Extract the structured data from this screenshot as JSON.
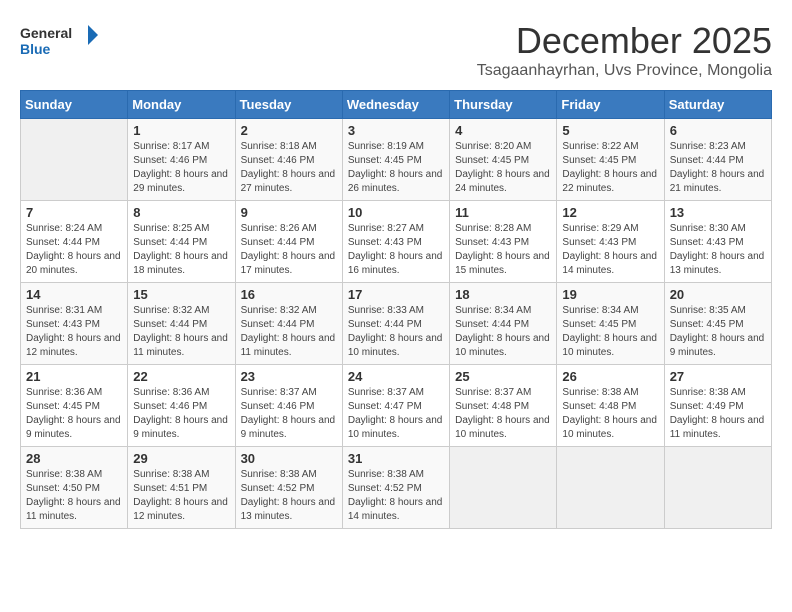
{
  "logo": {
    "line1": "General",
    "line2": "Blue"
  },
  "title": "December 2025",
  "location": "Tsagaanhayrhan, Uvs Province, Mongolia",
  "weekdays": [
    "Sunday",
    "Monday",
    "Tuesday",
    "Wednesday",
    "Thursday",
    "Friday",
    "Saturday"
  ],
  "weeks": [
    [
      {
        "day": "",
        "sunrise": "",
        "sunset": "",
        "daylight": ""
      },
      {
        "day": "1",
        "sunrise": "Sunrise: 8:17 AM",
        "sunset": "Sunset: 4:46 PM",
        "daylight": "Daylight: 8 hours and 29 minutes."
      },
      {
        "day": "2",
        "sunrise": "Sunrise: 8:18 AM",
        "sunset": "Sunset: 4:46 PM",
        "daylight": "Daylight: 8 hours and 27 minutes."
      },
      {
        "day": "3",
        "sunrise": "Sunrise: 8:19 AM",
        "sunset": "Sunset: 4:45 PM",
        "daylight": "Daylight: 8 hours and 26 minutes."
      },
      {
        "day": "4",
        "sunrise": "Sunrise: 8:20 AM",
        "sunset": "Sunset: 4:45 PM",
        "daylight": "Daylight: 8 hours and 24 minutes."
      },
      {
        "day": "5",
        "sunrise": "Sunrise: 8:22 AM",
        "sunset": "Sunset: 4:45 PM",
        "daylight": "Daylight: 8 hours and 22 minutes."
      },
      {
        "day": "6",
        "sunrise": "Sunrise: 8:23 AM",
        "sunset": "Sunset: 4:44 PM",
        "daylight": "Daylight: 8 hours and 21 minutes."
      }
    ],
    [
      {
        "day": "7",
        "sunrise": "Sunrise: 8:24 AM",
        "sunset": "Sunset: 4:44 PM",
        "daylight": "Daylight: 8 hours and 20 minutes."
      },
      {
        "day": "8",
        "sunrise": "Sunrise: 8:25 AM",
        "sunset": "Sunset: 4:44 PM",
        "daylight": "Daylight: 8 hours and 18 minutes."
      },
      {
        "day": "9",
        "sunrise": "Sunrise: 8:26 AM",
        "sunset": "Sunset: 4:44 PM",
        "daylight": "Daylight: 8 hours and 17 minutes."
      },
      {
        "day": "10",
        "sunrise": "Sunrise: 8:27 AM",
        "sunset": "Sunset: 4:43 PM",
        "daylight": "Daylight: 8 hours and 16 minutes."
      },
      {
        "day": "11",
        "sunrise": "Sunrise: 8:28 AM",
        "sunset": "Sunset: 4:43 PM",
        "daylight": "Daylight: 8 hours and 15 minutes."
      },
      {
        "day": "12",
        "sunrise": "Sunrise: 8:29 AM",
        "sunset": "Sunset: 4:43 PM",
        "daylight": "Daylight: 8 hours and 14 minutes."
      },
      {
        "day": "13",
        "sunrise": "Sunrise: 8:30 AM",
        "sunset": "Sunset: 4:43 PM",
        "daylight": "Daylight: 8 hours and 13 minutes."
      }
    ],
    [
      {
        "day": "14",
        "sunrise": "Sunrise: 8:31 AM",
        "sunset": "Sunset: 4:43 PM",
        "daylight": "Daylight: 8 hours and 12 minutes."
      },
      {
        "day": "15",
        "sunrise": "Sunrise: 8:32 AM",
        "sunset": "Sunset: 4:44 PM",
        "daylight": "Daylight: 8 hours and 11 minutes."
      },
      {
        "day": "16",
        "sunrise": "Sunrise: 8:32 AM",
        "sunset": "Sunset: 4:44 PM",
        "daylight": "Daylight: 8 hours and 11 minutes."
      },
      {
        "day": "17",
        "sunrise": "Sunrise: 8:33 AM",
        "sunset": "Sunset: 4:44 PM",
        "daylight": "Daylight: 8 hours and 10 minutes."
      },
      {
        "day": "18",
        "sunrise": "Sunrise: 8:34 AM",
        "sunset": "Sunset: 4:44 PM",
        "daylight": "Daylight: 8 hours and 10 minutes."
      },
      {
        "day": "19",
        "sunrise": "Sunrise: 8:34 AM",
        "sunset": "Sunset: 4:45 PM",
        "daylight": "Daylight: 8 hours and 10 minutes."
      },
      {
        "day": "20",
        "sunrise": "Sunrise: 8:35 AM",
        "sunset": "Sunset: 4:45 PM",
        "daylight": "Daylight: 8 hours and 9 minutes."
      }
    ],
    [
      {
        "day": "21",
        "sunrise": "Sunrise: 8:36 AM",
        "sunset": "Sunset: 4:45 PM",
        "daylight": "Daylight: 8 hours and 9 minutes."
      },
      {
        "day": "22",
        "sunrise": "Sunrise: 8:36 AM",
        "sunset": "Sunset: 4:46 PM",
        "daylight": "Daylight: 8 hours and 9 minutes."
      },
      {
        "day": "23",
        "sunrise": "Sunrise: 8:37 AM",
        "sunset": "Sunset: 4:46 PM",
        "daylight": "Daylight: 8 hours and 9 minutes."
      },
      {
        "day": "24",
        "sunrise": "Sunrise: 8:37 AM",
        "sunset": "Sunset: 4:47 PM",
        "daylight": "Daylight: 8 hours and 10 minutes."
      },
      {
        "day": "25",
        "sunrise": "Sunrise: 8:37 AM",
        "sunset": "Sunset: 4:48 PM",
        "daylight": "Daylight: 8 hours and 10 minutes."
      },
      {
        "day": "26",
        "sunrise": "Sunrise: 8:38 AM",
        "sunset": "Sunset: 4:48 PM",
        "daylight": "Daylight: 8 hours and 10 minutes."
      },
      {
        "day": "27",
        "sunrise": "Sunrise: 8:38 AM",
        "sunset": "Sunset: 4:49 PM",
        "daylight": "Daylight: 8 hours and 11 minutes."
      }
    ],
    [
      {
        "day": "28",
        "sunrise": "Sunrise: 8:38 AM",
        "sunset": "Sunset: 4:50 PM",
        "daylight": "Daylight: 8 hours and 11 minutes."
      },
      {
        "day": "29",
        "sunrise": "Sunrise: 8:38 AM",
        "sunset": "Sunset: 4:51 PM",
        "daylight": "Daylight: 8 hours and 12 minutes."
      },
      {
        "day": "30",
        "sunrise": "Sunrise: 8:38 AM",
        "sunset": "Sunset: 4:52 PM",
        "daylight": "Daylight: 8 hours and 13 minutes."
      },
      {
        "day": "31",
        "sunrise": "Sunrise: 8:38 AM",
        "sunset": "Sunset: 4:52 PM",
        "daylight": "Daylight: 8 hours and 14 minutes."
      },
      {
        "day": "",
        "sunrise": "",
        "sunset": "",
        "daylight": ""
      },
      {
        "day": "",
        "sunrise": "",
        "sunset": "",
        "daylight": ""
      },
      {
        "day": "",
        "sunrise": "",
        "sunset": "",
        "daylight": ""
      }
    ]
  ]
}
